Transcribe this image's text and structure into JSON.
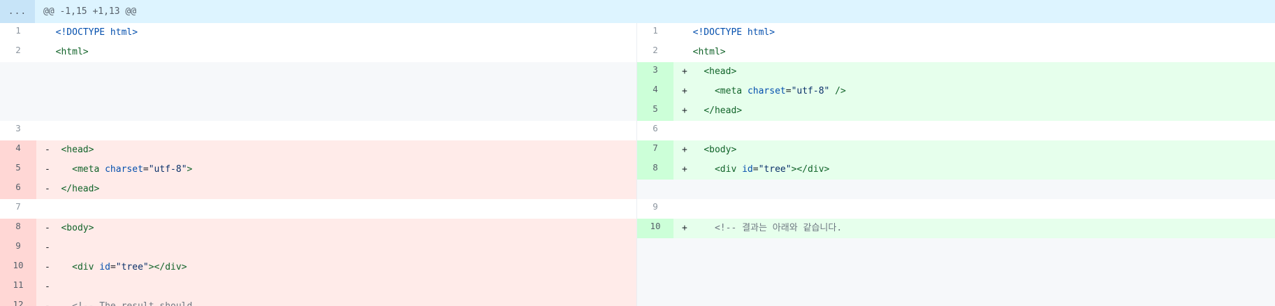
{
  "hunk": {
    "expand_label": "...",
    "header": "@@ -1,15 +1,13 @@"
  },
  "left": [
    {
      "type": "ctx",
      "num": "1",
      "marker": " ",
      "tokens": [
        {
          "t": "doctype",
          "v": "<!DOCTYPE html>"
        }
      ]
    },
    {
      "type": "ctx",
      "num": "2",
      "marker": " ",
      "tokens": [
        {
          "t": "tag",
          "v": "<html>"
        }
      ]
    },
    {
      "type": "empty",
      "num": "",
      "marker": "",
      "tokens": []
    },
    {
      "type": "empty",
      "num": "",
      "marker": "",
      "tokens": []
    },
    {
      "type": "empty",
      "num": "",
      "marker": "",
      "tokens": []
    },
    {
      "type": "ctx",
      "num": "3",
      "marker": " ",
      "tokens": []
    },
    {
      "type": "del",
      "num": "4",
      "marker": "-",
      "tokens": [
        {
          "t": "text",
          "v": " "
        },
        {
          "t": "tag",
          "v": "<head>"
        }
      ]
    },
    {
      "type": "del",
      "num": "5",
      "marker": "-",
      "tokens": [
        {
          "t": "text",
          "v": "   "
        },
        {
          "t": "tag",
          "v": "<meta "
        },
        {
          "t": "attr",
          "v": "charset"
        },
        {
          "t": "text",
          "v": "="
        },
        {
          "t": "str",
          "v": "\"utf-8\""
        },
        {
          "t": "tag",
          "v": ">"
        }
      ]
    },
    {
      "type": "del",
      "num": "6",
      "marker": "-",
      "tokens": [
        {
          "t": "text",
          "v": " "
        },
        {
          "t": "tag",
          "v": "</head>"
        }
      ]
    },
    {
      "type": "ctx",
      "num": "7",
      "marker": " ",
      "tokens": []
    },
    {
      "type": "del",
      "num": "8",
      "marker": "-",
      "tokens": [
        {
          "t": "text",
          "v": " "
        },
        {
          "t": "tag",
          "v": "<body>"
        }
      ]
    },
    {
      "type": "del",
      "num": "9",
      "marker": "-",
      "tokens": []
    },
    {
      "type": "del",
      "num": "10",
      "marker": "-",
      "tokens": [
        {
          "t": "text",
          "v": "   "
        },
        {
          "t": "tag",
          "v": "<div "
        },
        {
          "t": "attr",
          "v": "id"
        },
        {
          "t": "text",
          "v": "="
        },
        {
          "t": "str",
          "v": "\"tree\""
        },
        {
          "t": "tag",
          "v": "></div>"
        }
      ]
    },
    {
      "type": "del",
      "num": "11",
      "marker": "-",
      "tokens": []
    },
    {
      "type": "del",
      "num": "12",
      "marker": "-",
      "tokens": [
        {
          "t": "text",
          "v": "   "
        },
        {
          "t": "comment",
          "v": "<!-- The result should"
        }
      ]
    }
  ],
  "right": [
    {
      "type": "ctx",
      "num": "1",
      "marker": " ",
      "tokens": [
        {
          "t": "doctype",
          "v": "<!DOCTYPE html>"
        }
      ]
    },
    {
      "type": "ctx",
      "num": "2",
      "marker": " ",
      "tokens": [
        {
          "t": "tag",
          "v": "<html>"
        }
      ]
    },
    {
      "type": "add",
      "num": "3",
      "marker": "+",
      "tokens": [
        {
          "t": "text",
          "v": "  "
        },
        {
          "t": "tag",
          "v": "<head>"
        }
      ]
    },
    {
      "type": "add",
      "num": "4",
      "marker": "+",
      "tokens": [
        {
          "t": "text",
          "v": "    "
        },
        {
          "t": "tag",
          "v": "<meta "
        },
        {
          "t": "attr",
          "v": "charset"
        },
        {
          "t": "text",
          "v": "="
        },
        {
          "t": "str",
          "v": "\"utf-8\""
        },
        {
          "t": "tag",
          "v": " />"
        }
      ]
    },
    {
      "type": "add",
      "num": "5",
      "marker": "+",
      "tokens": [
        {
          "t": "text",
          "v": "  "
        },
        {
          "t": "tag",
          "v": "</head>"
        }
      ]
    },
    {
      "type": "ctx",
      "num": "6",
      "marker": " ",
      "tokens": []
    },
    {
      "type": "add",
      "num": "7",
      "marker": "+",
      "tokens": [
        {
          "t": "text",
          "v": "  "
        },
        {
          "t": "tag",
          "v": "<body>"
        }
      ]
    },
    {
      "type": "add",
      "num": "8",
      "marker": "+",
      "tokens": [
        {
          "t": "text",
          "v": "    "
        },
        {
          "t": "tag",
          "v": "<div "
        },
        {
          "t": "attr",
          "v": "id"
        },
        {
          "t": "text",
          "v": "="
        },
        {
          "t": "str",
          "v": "\"tree\""
        },
        {
          "t": "tag",
          "v": "></div>"
        }
      ]
    },
    {
      "type": "empty",
      "num": "",
      "marker": "",
      "tokens": []
    },
    {
      "type": "ctx",
      "num": "9",
      "marker": " ",
      "tokens": []
    },
    {
      "type": "add",
      "num": "10",
      "marker": "+",
      "tokens": [
        {
          "t": "text",
          "v": "    "
        },
        {
          "t": "comment",
          "v": "<!-- 결과는 아래와 같습니다."
        }
      ]
    }
  ]
}
